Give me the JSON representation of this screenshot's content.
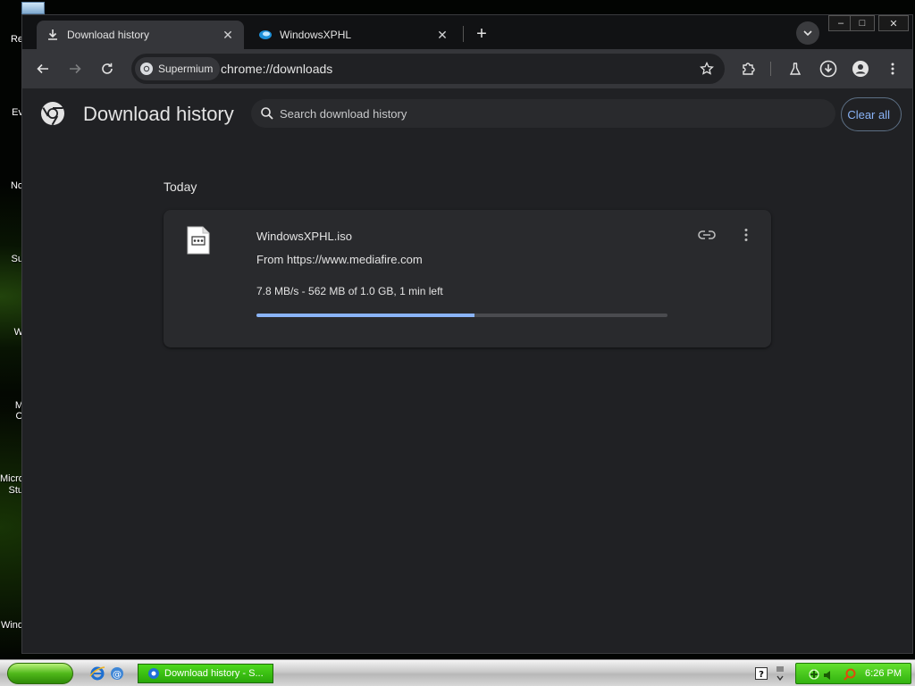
{
  "desktop": {
    "icon_labels": [
      "Re",
      "Ev",
      "No",
      "Su",
      "W",
      "M",
      "O",
      "Micro",
      "Stu",
      "Wind"
    ]
  },
  "browser": {
    "tabs": [
      {
        "title": "Download history",
        "icon": "download-icon",
        "active": true
      },
      {
        "title": "WindowsXPHL",
        "icon": "windowsxphl-favicon",
        "active": false
      }
    ],
    "window_controls": {
      "minimize": "–",
      "maximize": "□",
      "close": "✕"
    },
    "toolbar": {
      "site_chip": "Supermium",
      "url": "chrome://downloads"
    }
  },
  "downloads_page": {
    "title": "Download history",
    "search_placeholder": "Search download history",
    "clear_all_label": "Clear all",
    "date_group": "Today",
    "items": [
      {
        "file_name": "WindowsXPHL.iso",
        "source": "From https://www.mediafire.com",
        "progress_text": "7.8 MB/s - 562 MB of 1.0 GB, 1 min left",
        "progress_fraction": 0.53
      }
    ]
  },
  "taskbar": {
    "task_item_label": "Download history - S...",
    "clock": "6:26 PM"
  },
  "colors": {
    "accent": "#8ab4f8",
    "page_bg": "#202124",
    "card_bg": "#292a2d",
    "toolbar_bg": "#35363a",
    "xp_green": "#3fbf12"
  }
}
